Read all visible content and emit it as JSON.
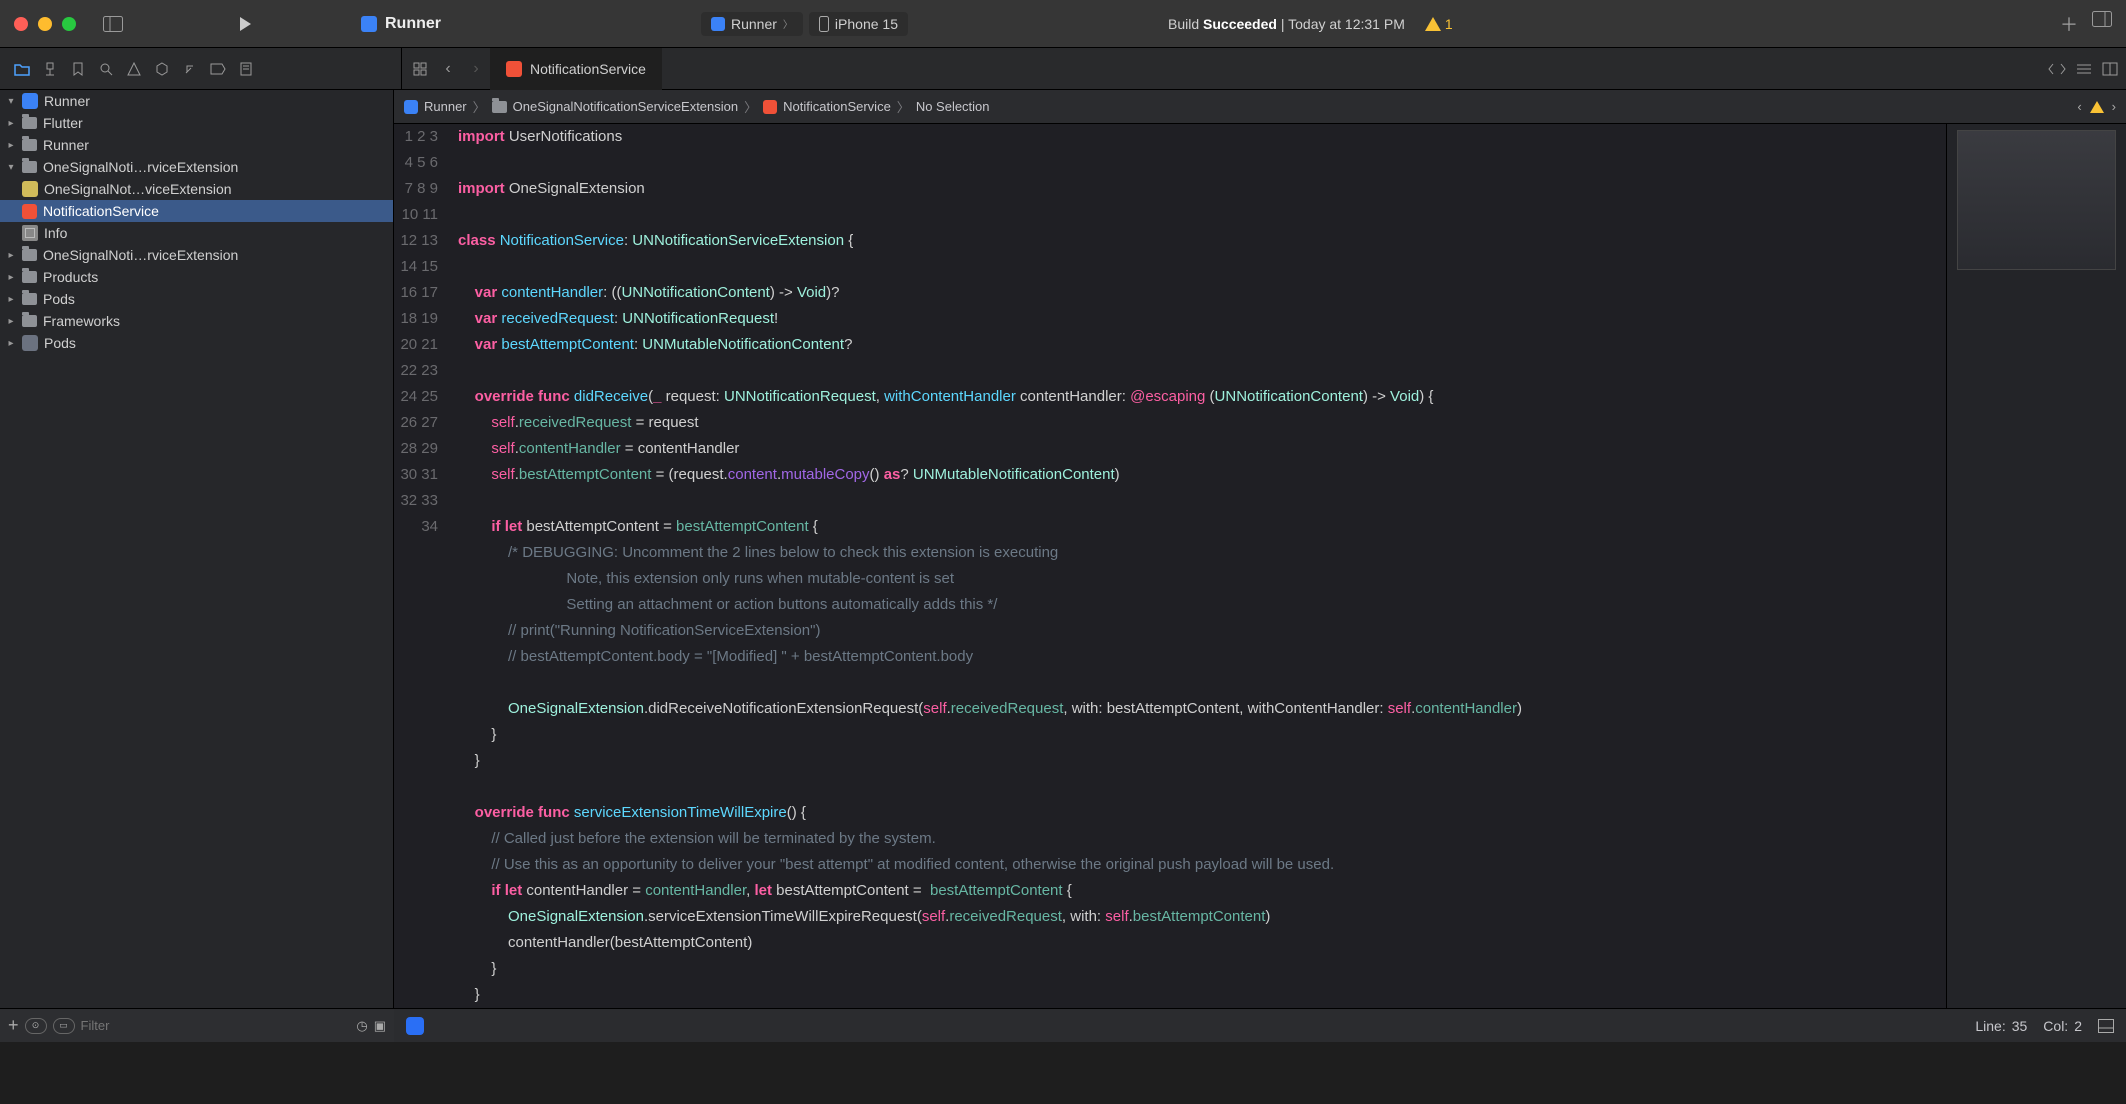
{
  "titlebar": {
    "project": "Runner",
    "scheme": "Runner",
    "device": "iPhone 15",
    "build_label": "Build",
    "build_status": "Succeeded",
    "build_time": "| Today at 12:31 PM",
    "warning_count": "1"
  },
  "tabs": {
    "open_file": "NotificationService"
  },
  "jumpbar": {
    "project": "Runner",
    "group": "OneSignalNotificationServiceExtension",
    "file": "NotificationService",
    "symbol": "No Selection"
  },
  "navigator": {
    "root": "Runner",
    "items": [
      {
        "label": "Flutter",
        "kind": "folder",
        "level": 1
      },
      {
        "label": "Runner",
        "kind": "folder",
        "level": 1
      },
      {
        "label": "OneSignalNoti…rviceExtension",
        "kind": "folder-open",
        "level": 1
      },
      {
        "label": "OneSignalNot…viceExtension",
        "kind": "ext",
        "level": 2
      },
      {
        "label": "NotificationService",
        "kind": "swift",
        "level": 2,
        "selected": true
      },
      {
        "label": "Info",
        "kind": "plist",
        "level": 2
      },
      {
        "label": "OneSignalNoti…rviceExtension",
        "kind": "folder",
        "level": 1
      },
      {
        "label": "Products",
        "kind": "folder",
        "level": 1
      },
      {
        "label": "Pods",
        "kind": "folder",
        "level": 1
      },
      {
        "label": "Frameworks",
        "kind": "folder",
        "level": 1
      }
    ],
    "secondary_root": "Pods",
    "filter_placeholder": "Filter"
  },
  "statusbar": {
    "line_label": "Line:",
    "line": "35",
    "col_label": "Col:",
    "col": "2"
  },
  "code": {
    "lines": [
      [
        {
          "t": "import",
          "c": "kw"
        },
        {
          "t": " "
        },
        {
          "t": "UserNotifications",
          "c": "id"
        }
      ],
      [],
      [
        {
          "t": "import",
          "c": "kw"
        },
        {
          "t": " "
        },
        {
          "t": "OneSignalExtension",
          "c": "id"
        }
      ],
      [],
      [
        {
          "t": "class",
          "c": "kw"
        },
        {
          "t": " "
        },
        {
          "t": "NotificationService",
          "c": "typeDecl"
        },
        {
          "t": ": "
        },
        {
          "t": "UNNotificationServiceExtension",
          "c": "type"
        },
        {
          "t": " {"
        }
      ],
      [],
      [
        {
          "t": "    "
        },
        {
          "t": "var",
          "c": "kw"
        },
        {
          "t": " "
        },
        {
          "t": "contentHandler",
          "c": "typeDecl"
        },
        {
          "t": ": (("
        },
        {
          "t": "UNNotificationContent",
          "c": "type"
        },
        {
          "t": ") -> "
        },
        {
          "t": "Void",
          "c": "type"
        },
        {
          "t": ")?"
        }
      ],
      [
        {
          "t": "    "
        },
        {
          "t": "var",
          "c": "kw"
        },
        {
          "t": " "
        },
        {
          "t": "receivedRequest",
          "c": "typeDecl"
        },
        {
          "t": ": "
        },
        {
          "t": "UNNotificationRequest",
          "c": "type"
        },
        {
          "t": "!"
        }
      ],
      [
        {
          "t": "    "
        },
        {
          "t": "var",
          "c": "kw"
        },
        {
          "t": " "
        },
        {
          "t": "bestAttemptContent",
          "c": "typeDecl"
        },
        {
          "t": ": "
        },
        {
          "t": "UNMutableNotificationContent",
          "c": "type"
        },
        {
          "t": "?"
        }
      ],
      [],
      [
        {
          "t": "    "
        },
        {
          "t": "override",
          "c": "kw"
        },
        {
          "t": " "
        },
        {
          "t": "func",
          "c": "kw"
        },
        {
          "t": " "
        },
        {
          "t": "didReceive",
          "c": "typeDecl"
        },
        {
          "t": "("
        },
        {
          "t": "_",
          "c": "kw"
        },
        {
          "t": " request: "
        },
        {
          "t": "UNNotificationRequest",
          "c": "type"
        },
        {
          "t": ", "
        },
        {
          "t": "withContentHandler",
          "c": "typeDecl"
        },
        {
          "t": " contentHandler: "
        },
        {
          "t": "@escaping",
          "c": "attr"
        },
        {
          "t": " ("
        },
        {
          "t": "UNNotificationContent",
          "c": "type"
        },
        {
          "t": ") -> "
        },
        {
          "t": "Void",
          "c": "type"
        },
        {
          "t": ") {"
        }
      ],
      [
        {
          "t": "        "
        },
        {
          "t": "self",
          "c": "self"
        },
        {
          "t": "."
        },
        {
          "t": "receivedRequest",
          "c": "prop"
        },
        {
          "t": " = request"
        }
      ],
      [
        {
          "t": "        "
        },
        {
          "t": "self",
          "c": "self"
        },
        {
          "t": "."
        },
        {
          "t": "contentHandler",
          "c": "prop"
        },
        {
          "t": " = contentHandler"
        }
      ],
      [
        {
          "t": "        "
        },
        {
          "t": "self",
          "c": "self"
        },
        {
          "t": "."
        },
        {
          "t": "bestAttemptContent",
          "c": "prop"
        },
        {
          "t": " = (request."
        },
        {
          "t": "content",
          "c": "fnCall"
        },
        {
          "t": "."
        },
        {
          "t": "mutableCopy",
          "c": "fnCall"
        },
        {
          "t": "() "
        },
        {
          "t": "as",
          "c": "kw"
        },
        {
          "t": "? "
        },
        {
          "t": "UNMutableNotificationContent",
          "c": "type"
        },
        {
          "t": ")"
        }
      ],
      [],
      [
        {
          "t": "        "
        },
        {
          "t": "if",
          "c": "kw"
        },
        {
          "t": " "
        },
        {
          "t": "let",
          "c": "kw"
        },
        {
          "t": " bestAttemptContent = "
        },
        {
          "t": "bestAttemptContent",
          "c": "prop"
        },
        {
          "t": " {"
        }
      ],
      [
        {
          "t": "            "
        },
        {
          "t": "/* DEBUGGING: Uncomment the 2 lines below to check this extension is executing",
          "c": "cmtblk"
        }
      ],
      [
        {
          "t": "                          Note, this extension only runs when mutable-content is set",
          "c": "cmtblk"
        }
      ],
      [
        {
          "t": "                          Setting an attachment or action buttons automatically adds this */",
          "c": "cmtblk"
        }
      ],
      [
        {
          "t": "            "
        },
        {
          "t": "// print(\"Running NotificationServiceExtension\")",
          "c": "cmt"
        }
      ],
      [
        {
          "t": "            "
        },
        {
          "t": "// bestAttemptContent.body = \"[Modified] \" + bestAttemptContent.body",
          "c": "cmt"
        }
      ],
      [],
      [
        {
          "t": "            "
        },
        {
          "t": "OneSignalExtension",
          "c": "type"
        },
        {
          "t": ".didReceiveNotificationExtensionRequest("
        },
        {
          "t": "self",
          "c": "self"
        },
        {
          "t": "."
        },
        {
          "t": "receivedRequest",
          "c": "prop"
        },
        {
          "t": ", with: bestAttemptContent, withContentHandler: "
        },
        {
          "t": "self",
          "c": "self"
        },
        {
          "t": "."
        },
        {
          "t": "contentHandler",
          "c": "prop"
        },
        {
          "t": ")"
        }
      ],
      [
        {
          "t": "        }"
        }
      ],
      [
        {
          "t": "    }"
        }
      ],
      [],
      [
        {
          "t": "    "
        },
        {
          "t": "override",
          "c": "kw"
        },
        {
          "t": " "
        },
        {
          "t": "func",
          "c": "kw"
        },
        {
          "t": " "
        },
        {
          "t": "serviceExtensionTimeWillExpire",
          "c": "typeDecl"
        },
        {
          "t": "() {"
        }
      ],
      [
        {
          "t": "        "
        },
        {
          "t": "// Called just before the extension will be terminated by the system.",
          "c": "cmt"
        }
      ],
      [
        {
          "t": "        "
        },
        {
          "t": "// Use this as an opportunity to deliver your \"best attempt\" at modified content, otherwise the original push payload will be used.",
          "c": "cmt"
        }
      ],
      [
        {
          "t": "        "
        },
        {
          "t": "if",
          "c": "kw"
        },
        {
          "t": " "
        },
        {
          "t": "let",
          "c": "kw"
        },
        {
          "t": " contentHandler = "
        },
        {
          "t": "contentHandler",
          "c": "prop"
        },
        {
          "t": ", "
        },
        {
          "t": "let",
          "c": "kw"
        },
        {
          "t": " bestAttemptContent =  "
        },
        {
          "t": "bestAttemptContent",
          "c": "prop"
        },
        {
          "t": " {"
        }
      ],
      [
        {
          "t": "            "
        },
        {
          "t": "OneSignalExtension",
          "c": "type"
        },
        {
          "t": ".serviceExtensionTimeWillExpireRequest("
        },
        {
          "t": "self",
          "c": "self"
        },
        {
          "t": "."
        },
        {
          "t": "receivedRequest",
          "c": "prop"
        },
        {
          "t": ", with: "
        },
        {
          "t": "self",
          "c": "self"
        },
        {
          "t": "."
        },
        {
          "t": "bestAttemptContent",
          "c": "prop"
        },
        {
          "t": ")"
        }
      ],
      [
        {
          "t": "            contentHandler(bestAttemptContent)"
        }
      ],
      [
        {
          "t": "        }"
        }
      ],
      [
        {
          "t": "    }"
        }
      ]
    ]
  }
}
